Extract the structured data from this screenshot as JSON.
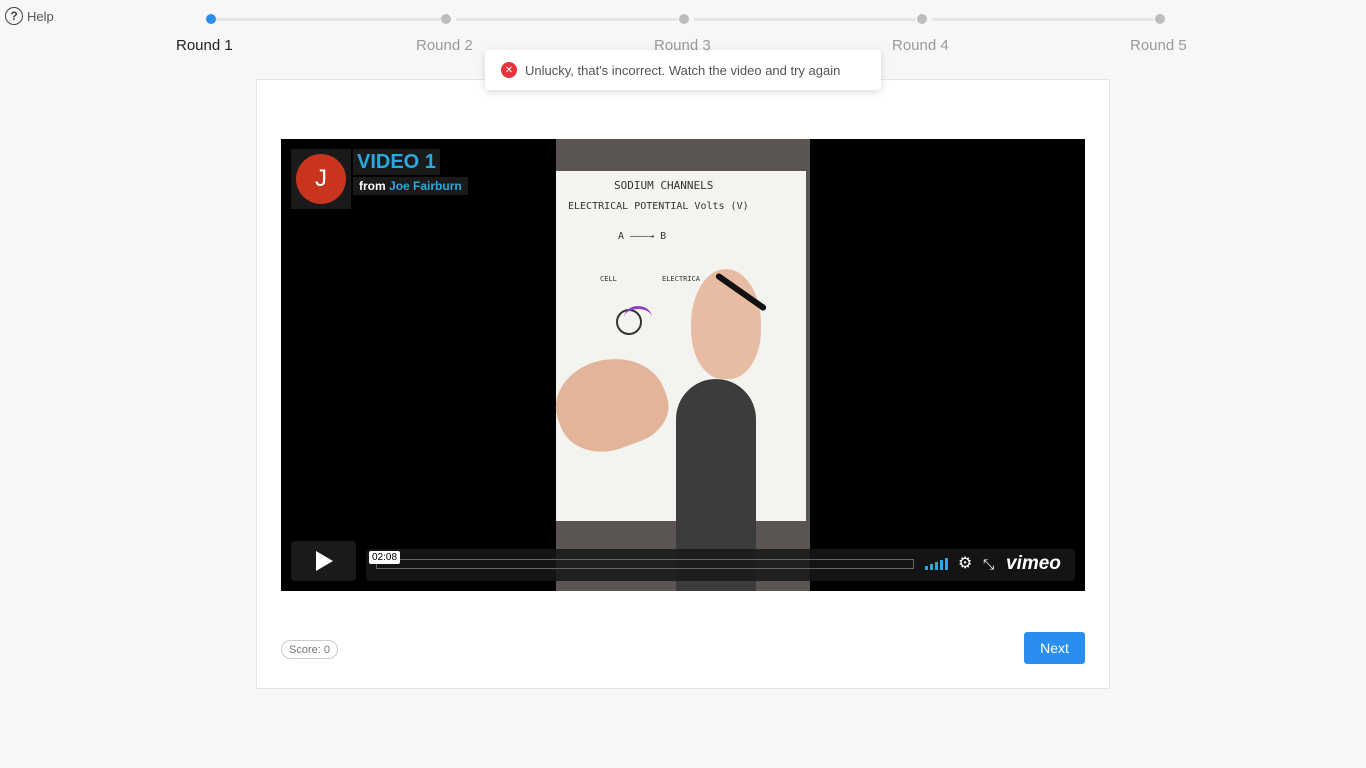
{
  "help": {
    "label": "Help",
    "icon": "question-circle-icon"
  },
  "steps": [
    {
      "label": "Round 1",
      "active": true
    },
    {
      "label": "Round 2",
      "active": false
    },
    {
      "label": "Round 3",
      "active": false
    },
    {
      "label": "Round 4",
      "active": false
    },
    {
      "label": "Round 5",
      "active": false
    }
  ],
  "toast": {
    "message": "Unlucky, that's incorrect. Watch the video and try again",
    "icon": "error-circle-icon",
    "color": "#e8343c"
  },
  "video": {
    "title": "VIDEO 1",
    "byline_prefix": "from",
    "author": "Joe Fairburn",
    "avatar_letter": "J",
    "time": "02:08",
    "brand": "vimeo",
    "accent": "#2aa9e0",
    "board": {
      "line1": "SODIUM CHANNELS",
      "line2": "ELECTRICAL POTENTIAL   Volts (V)",
      "line3": "A ———→ B",
      "line4": "CELL",
      "line5": "ELECTRICA"
    }
  },
  "footer": {
    "score": "Score: 0",
    "next_label": "Next"
  },
  "colors": {
    "primary": "#2a8ef0",
    "error": "#e8343c"
  }
}
